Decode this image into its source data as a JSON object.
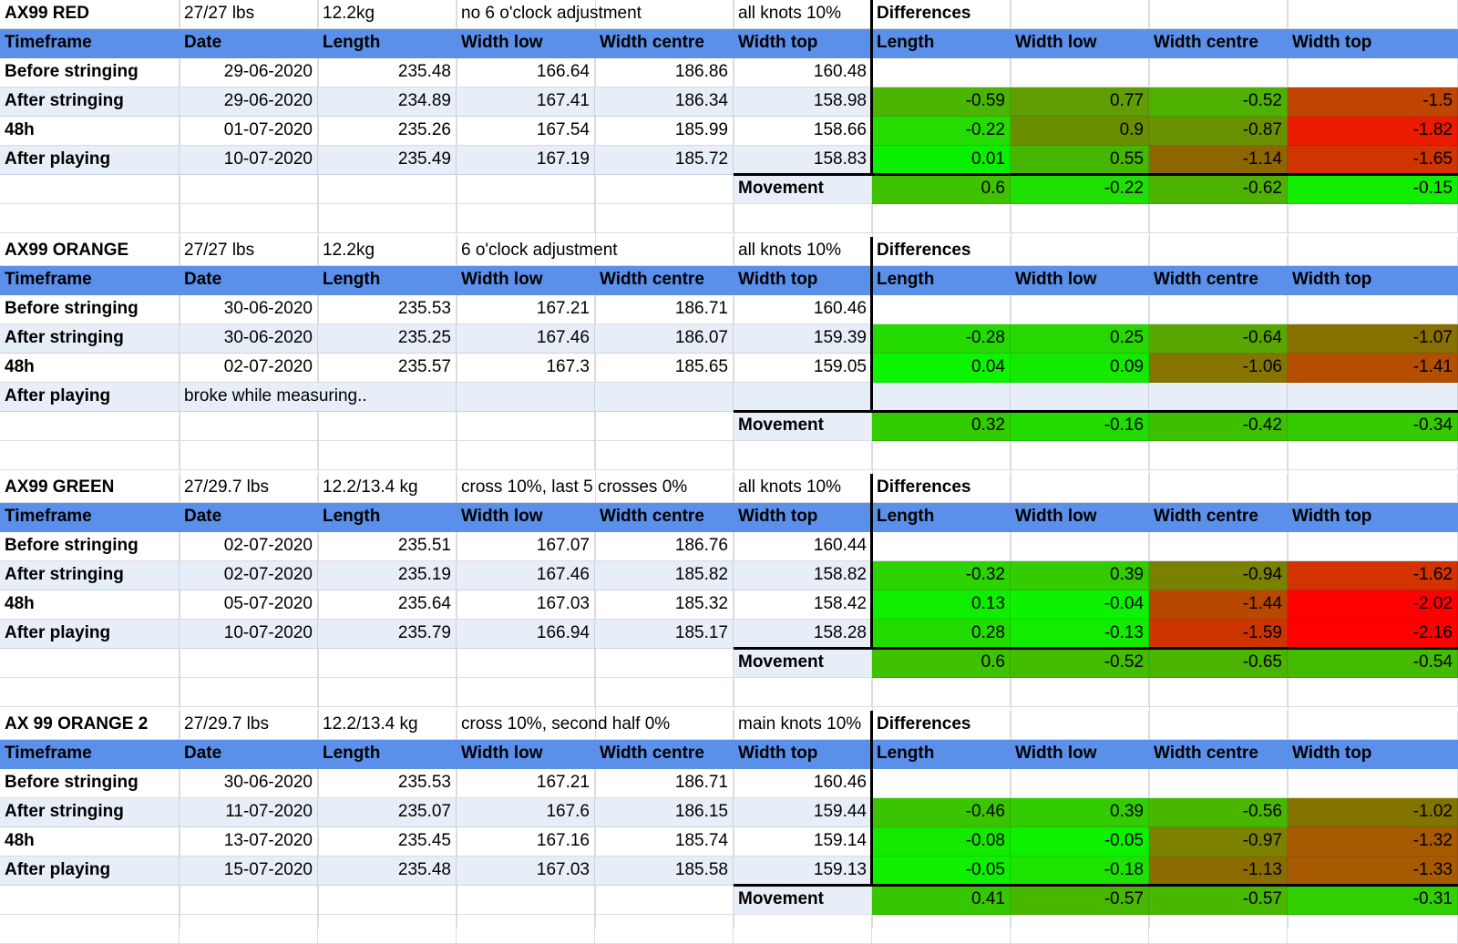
{
  "columns": [
    "Timeframe",
    "Date",
    "Length",
    "Width low",
    "Width centre",
    "Width top",
    "Length",
    "Width low",
    "Width centre",
    "Width top"
  ],
  "difference_header": "Differences",
  "movement_label": "Movement",
  "blocks": [
    {
      "meta": [
        "AX99 RED",
        "27/27 lbs",
        "12.2kg",
        "no 6 o'clock adjustment",
        "",
        "all knots 10%"
      ],
      "rows": [
        {
          "label": "Before stringing",
          "date": "29-06-2020",
          "length": "235.48",
          "wlow": "166.64",
          "wcentre": "186.86",
          "wtop": "160.48"
        },
        {
          "label": "After stringing",
          "date": "29-06-2020",
          "length": "234.89",
          "wlow": "167.41",
          "wcentre": "186.34",
          "wtop": "158.98",
          "diff": [
            "-0.59",
            "0.77",
            "-0.52",
            "-1.5"
          ],
          "diffColors": [
            "#4ab400",
            "#5f9d00",
            "#4eb100",
            "#c04500"
          ]
        },
        {
          "label": "48h",
          "date": "01-07-2020",
          "length": "235.26",
          "wlow": "167.54",
          "wcentre": "185.99",
          "wtop": "158.66",
          "diff": [
            "-0.22",
            "0.9",
            "-0.87",
            "-1.82"
          ],
          "diffColors": [
            "#24dc00",
            "#6a8f00",
            "#6a9100",
            "#eb1b00"
          ]
        },
        {
          "label": "After playing",
          "date": "10-07-2020",
          "length": "235.49",
          "wlow": "167.19",
          "wcentre": "185.72",
          "wtop": "158.83",
          "diff": [
            "0.01",
            "0.55",
            "-1.14",
            "-1.65"
          ],
          "diffColors": [
            "#0aef00",
            "#46b700",
            "#8d6600",
            "#d03400"
          ]
        }
      ],
      "movement": [
        "0.6",
        "-0.22",
        "-0.62",
        "-0.15"
      ],
      "movementColors": [
        "#3fc200",
        "#1fe000",
        "#4eb200",
        "#12ee00"
      ]
    },
    {
      "meta": [
        "AX99 ORANGE",
        "27/27 lbs",
        "12.2kg",
        "6 o'clock adjustment",
        "",
        "all knots 10%"
      ],
      "rows": [
        {
          "label": "Before stringing",
          "date": "30-06-2020",
          "length": "235.53",
          "wlow": "167.21",
          "wcentre": "186.71",
          "wtop": "160.46"
        },
        {
          "label": "After stringing",
          "date": "30-06-2020",
          "length": "235.25",
          "wlow": "167.46",
          "wcentre": "186.07",
          "wtop": "159.39",
          "diff": [
            "-0.28",
            "0.25",
            "-0.64",
            "-1.07"
          ],
          "diffColors": [
            "#25da00",
            "#27d800",
            "#59a600",
            "#877000"
          ]
        },
        {
          "label": "48h",
          "date": "02-07-2020",
          "length": "235.57",
          "wlow": "167.3",
          "wcentre": "185.65",
          "wtop": "159.05",
          "diff": [
            "0.04",
            "0.09",
            "-1.06",
            "-1.41"
          ],
          "diffColors": [
            "#0bf400",
            "#14ea00",
            "#857500",
            "#b54e00"
          ]
        },
        {
          "label": "After playing",
          "note": "broke while measuring..",
          "date": "",
          "length": "",
          "wlow": "",
          "wcentre": "",
          "wtop": "",
          "diff": [
            "",
            "",
            "",
            ""
          ],
          "diffColors": [
            "#e8eef8",
            "#e8eef8",
            "#e8eef8",
            "#e8eef8"
          ]
        }
      ],
      "movement": [
        "0.32",
        "-0.16",
        "-0.42",
        "-0.34"
      ],
      "movementColors": [
        "#33cc00",
        "#22dc00",
        "#3dc000",
        "#34cb00"
      ]
    },
    {
      "meta": [
        "AX99 GREEN",
        "27/29.7 lbs",
        "12.2/13.4 kg",
        "cross 10%, last 5 crosses 0%",
        "",
        "all knots 10%"
      ],
      "rows": [
        {
          "label": "Before stringing",
          "date": "02-07-2020",
          "length": "235.51",
          "wlow": "167.07",
          "wcentre": "186.76",
          "wtop": "160.44"
        },
        {
          "label": "After stringing",
          "date": "02-07-2020",
          "length": "235.19",
          "wlow": "167.46",
          "wcentre": "185.82",
          "wtop": "158.82",
          "diff": [
            "-0.32",
            "0.39",
            "-0.94",
            "-1.62"
          ],
          "diffColors": [
            "#2bd300",
            "#32cc00",
            "#7a8100",
            "#d23300"
          ]
        },
        {
          "label": "48h",
          "date": "05-07-2020",
          "length": "235.64",
          "wlow": "167.03",
          "wcentre": "185.32",
          "wtop": "158.42",
          "diff": [
            "0.13",
            "-0.04",
            "-1.44",
            "-2.02"
          ],
          "diffColors": [
            "#10ee00",
            "#0cf200",
            "#b84800",
            "#ff0000"
          ]
        },
        {
          "label": "After playing",
          "date": "10-07-2020",
          "length": "235.79",
          "wlow": "166.94",
          "wcentre": "185.17",
          "wtop": "158.28",
          "diff": [
            "0.28",
            "-0.13",
            "-1.59",
            "-2.16"
          ],
          "diffColors": [
            "#22dc00",
            "#12ec00",
            "#cc3500",
            "#ff0000"
          ]
        }
      ],
      "movement": [
        "0.6",
        "-0.52",
        "-0.65",
        "-0.54"
      ],
      "movementColors": [
        "#3fc200",
        "#42bd00",
        "#4ab400",
        "#44bb00"
      ]
    },
    {
      "meta": [
        "AX 99 ORANGE 2",
        "27/29.7 lbs",
        "12.2/13.4 kg",
        "cross 10%, second half 0%",
        "",
        "main knots 10%"
      ],
      "rows": [
        {
          "label": "Before stringing",
          "date": "30-06-2020",
          "length": "235.53",
          "wlow": "167.21",
          "wcentre": "186.71",
          "wtop": "160.46"
        },
        {
          "label": "After stringing",
          "date": "11-07-2020",
          "length": "235.07",
          "wlow": "167.6",
          "wcentre": "186.15",
          "wtop": "159.44",
          "diff": [
            "-0.46",
            "0.39",
            "-0.56",
            "-1.02"
          ],
          "diffColors": [
            "#3ac500",
            "#32cc00",
            "#49b600",
            "#837400"
          ]
        },
        {
          "label": "48h",
          "date": "13-07-2020",
          "length": "235.45",
          "wlow": "167.16",
          "wcentre": "185.74",
          "wtop": "159.14",
          "diff": [
            "-0.08",
            "-0.05",
            "-0.97",
            "-1.32"
          ],
          "diffColors": [
            "#14ea00",
            "#0df100",
            "#7c8200",
            "#a75a00"
          ]
        },
        {
          "label": "After playing",
          "date": "15-07-2020",
          "length": "235.48",
          "wlow": "167.03",
          "wcentre": "185.58",
          "wtop": "159.13",
          "diff": [
            "-0.05",
            "-0.18",
            "-1.13",
            "-1.33"
          ],
          "diffColors": [
            "#0ff000",
            "#1de300",
            "#8b6c00",
            "#a85a00"
          ]
        }
      ],
      "movement": [
        "0.41",
        "-0.57",
        "-0.57",
        "-0.31"
      ],
      "movementColors": [
        "#36c700",
        "#48b700",
        "#48b700",
        "#2fcf00"
      ]
    }
  ]
}
